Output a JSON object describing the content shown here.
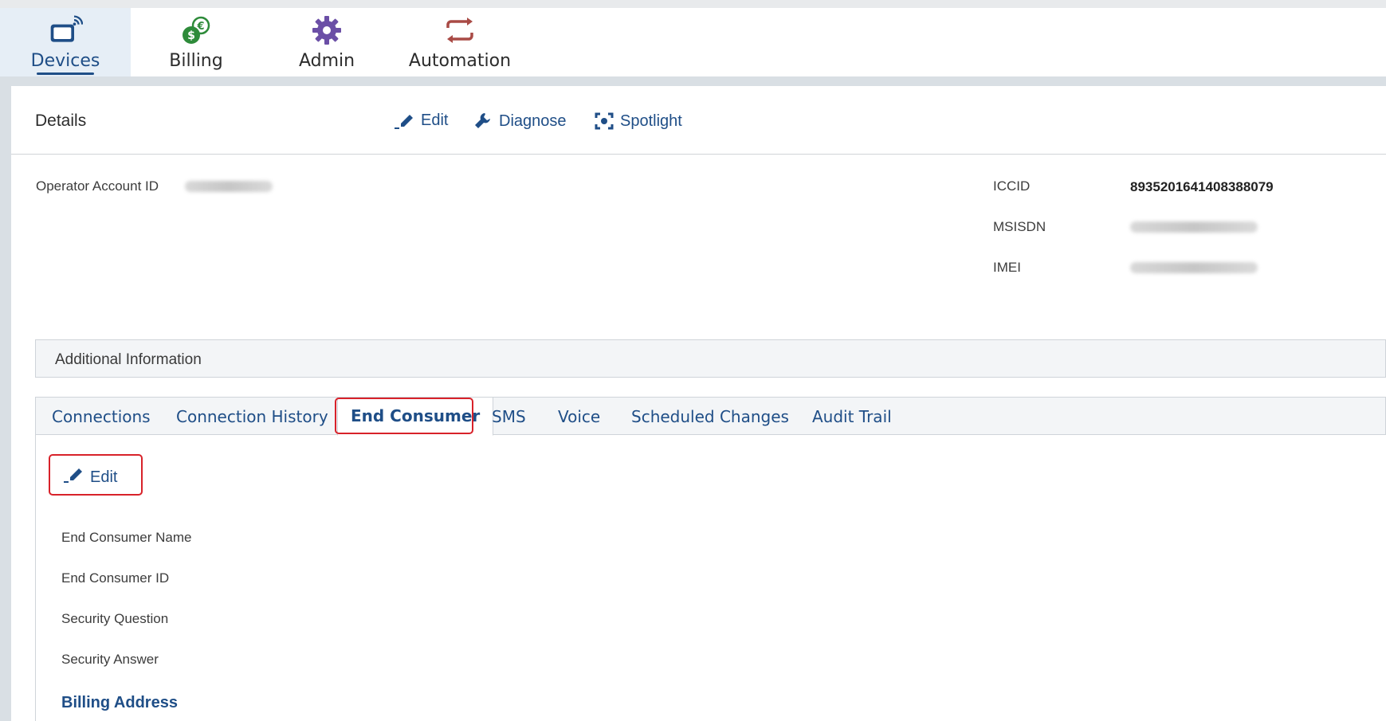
{
  "nav": {
    "items": [
      {
        "label": "Devices",
        "icon": "devices-icon",
        "active": true
      },
      {
        "label": "Billing",
        "icon": "billing-icon",
        "active": false
      },
      {
        "label": "Admin",
        "icon": "gear-icon",
        "active": false
      },
      {
        "label": "Automation",
        "icon": "automation-icon",
        "active": false
      }
    ]
  },
  "details": {
    "title": "Details",
    "actions": {
      "edit": "Edit",
      "diagnose": "Diagnose",
      "spotlight": "Spotlight"
    }
  },
  "fields": {
    "operator_account_id_label": "Operator Account ID",
    "iccid_label": "ICCID",
    "iccid_value": "8935201641408388079",
    "msisdn_label": "MSISDN",
    "imei_label": "IMEI"
  },
  "additional_info": {
    "title": "Additional Information"
  },
  "tabs": [
    {
      "label": "Connections"
    },
    {
      "label": "Connection History"
    },
    {
      "label": "End Consumer"
    },
    {
      "label": "SMS"
    },
    {
      "label": "Voice"
    },
    {
      "label": "Scheduled Changes"
    },
    {
      "label": "Audit Trail"
    }
  ],
  "end_consumer": {
    "edit_label": "Edit",
    "name_label": "End Consumer Name",
    "id_label": "End Consumer ID",
    "security_question_label": "Security Question",
    "security_answer_label": "Security Answer",
    "billing_address_heading": "Billing Address"
  },
  "colors": {
    "accent": "#1f4e87",
    "highlight": "#d8222a",
    "billing_green": "#2e8b3a",
    "admin_purple": "#6b4fa6",
    "automation_red": "#a94a45"
  }
}
